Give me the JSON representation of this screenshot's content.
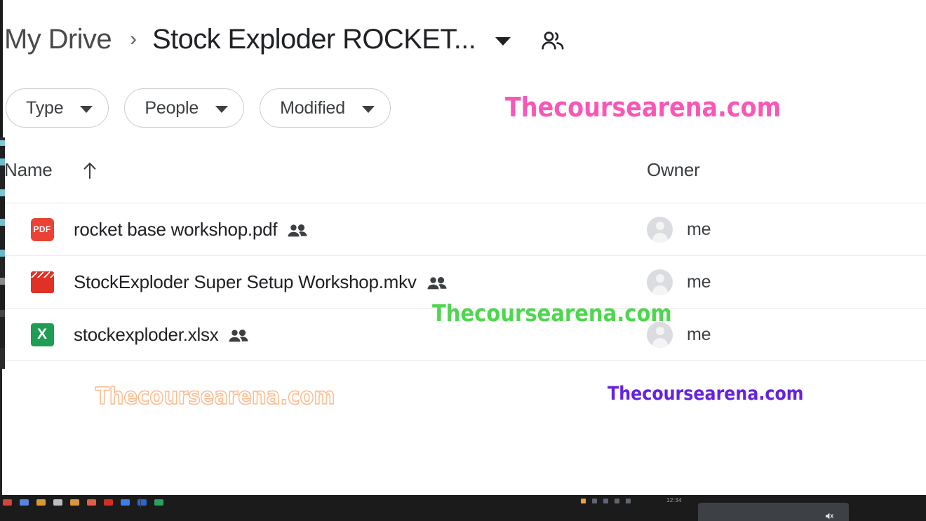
{
  "breadcrumb": {
    "root_label": "My Drive",
    "separator": "›",
    "current_label": "Stock Exploder ROCKET...",
    "caret_icon": "chevron-down-icon",
    "people_icon": "shared-people-icon"
  },
  "filters": [
    {
      "label": "Type",
      "caret_icon": "chevron-down-icon"
    },
    {
      "label": "People",
      "caret_icon": "chevron-down-icon"
    },
    {
      "label": "Modified",
      "caret_icon": "chevron-down-icon"
    }
  ],
  "table": {
    "columns": {
      "name": "Name",
      "owner": "Owner"
    },
    "sort": {
      "column": "Name",
      "direction": "ascending",
      "icon": "arrow-up-icon"
    },
    "rows": [
      {
        "file_name": "rocket base workshop.pdf",
        "file_type": "pdf",
        "icon_label": "PDF",
        "icon_name": "pdf-file-icon",
        "icon_color": "#ea4335",
        "shared_icon": "shared-people-icon",
        "owner": "me",
        "owner_avatar": "default-avatar-icon"
      },
      {
        "file_name": "StockExploder Super Setup Workshop.mkv",
        "file_type": "video",
        "icon_label": "",
        "icon_name": "video-file-icon",
        "icon_color": "#e03127",
        "shared_icon": "shared-people-icon",
        "owner": "me",
        "owner_avatar": "default-avatar-icon"
      },
      {
        "file_name": "stockexploder.xlsx",
        "file_type": "spreadsheet",
        "icon_label": "X",
        "icon_name": "spreadsheet-file-icon",
        "icon_color": "#1e9e54",
        "shared_icon": "shared-people-icon",
        "owner": "me",
        "owner_avatar": "default-avatar-icon"
      }
    ]
  },
  "watermarks": [
    {
      "text": "Thecoursearena.com",
      "color": "#f957b8",
      "style": "solid"
    },
    {
      "text": "Thecoursearena.com",
      "color": "#4fd64f",
      "style": "solid"
    },
    {
      "text": "Thecoursearena.com",
      "color": "#ffb98a",
      "style": "outline"
    },
    {
      "text": "Thecoursearena.com",
      "color": "#6622dd",
      "style": "solid"
    }
  ],
  "taskbar": {
    "clock": "12:34",
    "icon_colors": [
      "#e8453c",
      "#5b8def",
      "#e8a33d",
      "#c8ccd0",
      "#e8a33d",
      "#f06449",
      "#e03127",
      "#4285f4",
      "#2b6ed9",
      "#2eaa63"
    ]
  }
}
